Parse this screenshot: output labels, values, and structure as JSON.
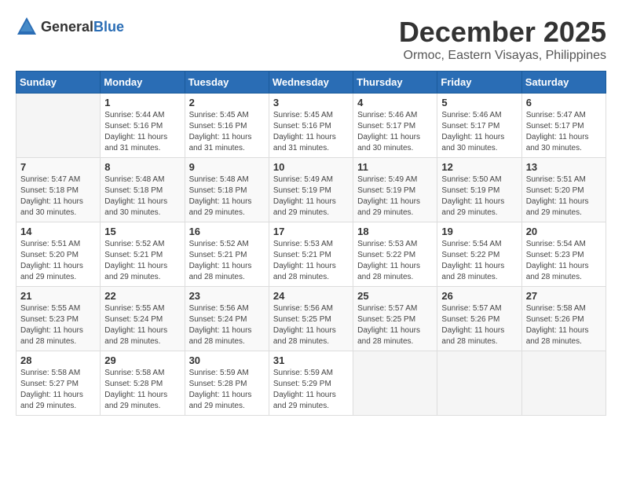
{
  "header": {
    "logo_general": "General",
    "logo_blue": "Blue",
    "month": "December 2025",
    "location": "Ormoc, Eastern Visayas, Philippines"
  },
  "weekdays": [
    "Sunday",
    "Monday",
    "Tuesday",
    "Wednesday",
    "Thursday",
    "Friday",
    "Saturday"
  ],
  "weeks": [
    [
      {
        "day": "",
        "sunrise": "",
        "sunset": "",
        "daylight": ""
      },
      {
        "day": "1",
        "sunrise": "Sunrise: 5:44 AM",
        "sunset": "Sunset: 5:16 PM",
        "daylight": "Daylight: 11 hours and 31 minutes."
      },
      {
        "day": "2",
        "sunrise": "Sunrise: 5:45 AM",
        "sunset": "Sunset: 5:16 PM",
        "daylight": "Daylight: 11 hours and 31 minutes."
      },
      {
        "day": "3",
        "sunrise": "Sunrise: 5:45 AM",
        "sunset": "Sunset: 5:16 PM",
        "daylight": "Daylight: 11 hours and 31 minutes."
      },
      {
        "day": "4",
        "sunrise": "Sunrise: 5:46 AM",
        "sunset": "Sunset: 5:17 PM",
        "daylight": "Daylight: 11 hours and 30 minutes."
      },
      {
        "day": "5",
        "sunrise": "Sunrise: 5:46 AM",
        "sunset": "Sunset: 5:17 PM",
        "daylight": "Daylight: 11 hours and 30 minutes."
      },
      {
        "day": "6",
        "sunrise": "Sunrise: 5:47 AM",
        "sunset": "Sunset: 5:17 PM",
        "daylight": "Daylight: 11 hours and 30 minutes."
      }
    ],
    [
      {
        "day": "7",
        "sunrise": "Sunrise: 5:47 AM",
        "sunset": "Sunset: 5:18 PM",
        "daylight": "Daylight: 11 hours and 30 minutes."
      },
      {
        "day": "8",
        "sunrise": "Sunrise: 5:48 AM",
        "sunset": "Sunset: 5:18 PM",
        "daylight": "Daylight: 11 hours and 30 minutes."
      },
      {
        "day": "9",
        "sunrise": "Sunrise: 5:48 AM",
        "sunset": "Sunset: 5:18 PM",
        "daylight": "Daylight: 11 hours and 29 minutes."
      },
      {
        "day": "10",
        "sunrise": "Sunrise: 5:49 AM",
        "sunset": "Sunset: 5:19 PM",
        "daylight": "Daylight: 11 hours and 29 minutes."
      },
      {
        "day": "11",
        "sunrise": "Sunrise: 5:49 AM",
        "sunset": "Sunset: 5:19 PM",
        "daylight": "Daylight: 11 hours and 29 minutes."
      },
      {
        "day": "12",
        "sunrise": "Sunrise: 5:50 AM",
        "sunset": "Sunset: 5:19 PM",
        "daylight": "Daylight: 11 hours and 29 minutes."
      },
      {
        "day": "13",
        "sunrise": "Sunrise: 5:51 AM",
        "sunset": "Sunset: 5:20 PM",
        "daylight": "Daylight: 11 hours and 29 minutes."
      }
    ],
    [
      {
        "day": "14",
        "sunrise": "Sunrise: 5:51 AM",
        "sunset": "Sunset: 5:20 PM",
        "daylight": "Daylight: 11 hours and 29 minutes."
      },
      {
        "day": "15",
        "sunrise": "Sunrise: 5:52 AM",
        "sunset": "Sunset: 5:21 PM",
        "daylight": "Daylight: 11 hours and 29 minutes."
      },
      {
        "day": "16",
        "sunrise": "Sunrise: 5:52 AM",
        "sunset": "Sunset: 5:21 PM",
        "daylight": "Daylight: 11 hours and 28 minutes."
      },
      {
        "day": "17",
        "sunrise": "Sunrise: 5:53 AM",
        "sunset": "Sunset: 5:21 PM",
        "daylight": "Daylight: 11 hours and 28 minutes."
      },
      {
        "day": "18",
        "sunrise": "Sunrise: 5:53 AM",
        "sunset": "Sunset: 5:22 PM",
        "daylight": "Daylight: 11 hours and 28 minutes."
      },
      {
        "day": "19",
        "sunrise": "Sunrise: 5:54 AM",
        "sunset": "Sunset: 5:22 PM",
        "daylight": "Daylight: 11 hours and 28 minutes."
      },
      {
        "day": "20",
        "sunrise": "Sunrise: 5:54 AM",
        "sunset": "Sunset: 5:23 PM",
        "daylight": "Daylight: 11 hours and 28 minutes."
      }
    ],
    [
      {
        "day": "21",
        "sunrise": "Sunrise: 5:55 AM",
        "sunset": "Sunset: 5:23 PM",
        "daylight": "Daylight: 11 hours and 28 minutes."
      },
      {
        "day": "22",
        "sunrise": "Sunrise: 5:55 AM",
        "sunset": "Sunset: 5:24 PM",
        "daylight": "Daylight: 11 hours and 28 minutes."
      },
      {
        "day": "23",
        "sunrise": "Sunrise: 5:56 AM",
        "sunset": "Sunset: 5:24 PM",
        "daylight": "Daylight: 11 hours and 28 minutes."
      },
      {
        "day": "24",
        "sunrise": "Sunrise: 5:56 AM",
        "sunset": "Sunset: 5:25 PM",
        "daylight": "Daylight: 11 hours and 28 minutes."
      },
      {
        "day": "25",
        "sunrise": "Sunrise: 5:57 AM",
        "sunset": "Sunset: 5:25 PM",
        "daylight": "Daylight: 11 hours and 28 minutes."
      },
      {
        "day": "26",
        "sunrise": "Sunrise: 5:57 AM",
        "sunset": "Sunset: 5:26 PM",
        "daylight": "Daylight: 11 hours and 28 minutes."
      },
      {
        "day": "27",
        "sunrise": "Sunrise: 5:58 AM",
        "sunset": "Sunset: 5:26 PM",
        "daylight": "Daylight: 11 hours and 28 minutes."
      }
    ],
    [
      {
        "day": "28",
        "sunrise": "Sunrise: 5:58 AM",
        "sunset": "Sunset: 5:27 PM",
        "daylight": "Daylight: 11 hours and 29 minutes."
      },
      {
        "day": "29",
        "sunrise": "Sunrise: 5:58 AM",
        "sunset": "Sunset: 5:28 PM",
        "daylight": "Daylight: 11 hours and 29 minutes."
      },
      {
        "day": "30",
        "sunrise": "Sunrise: 5:59 AM",
        "sunset": "Sunset: 5:28 PM",
        "daylight": "Daylight: 11 hours and 29 minutes."
      },
      {
        "day": "31",
        "sunrise": "Sunrise: 5:59 AM",
        "sunset": "Sunset: 5:29 PM",
        "daylight": "Daylight: 11 hours and 29 minutes."
      },
      {
        "day": "",
        "sunrise": "",
        "sunset": "",
        "daylight": ""
      },
      {
        "day": "",
        "sunrise": "",
        "sunset": "",
        "daylight": ""
      },
      {
        "day": "",
        "sunrise": "",
        "sunset": "",
        "daylight": ""
      }
    ]
  ]
}
